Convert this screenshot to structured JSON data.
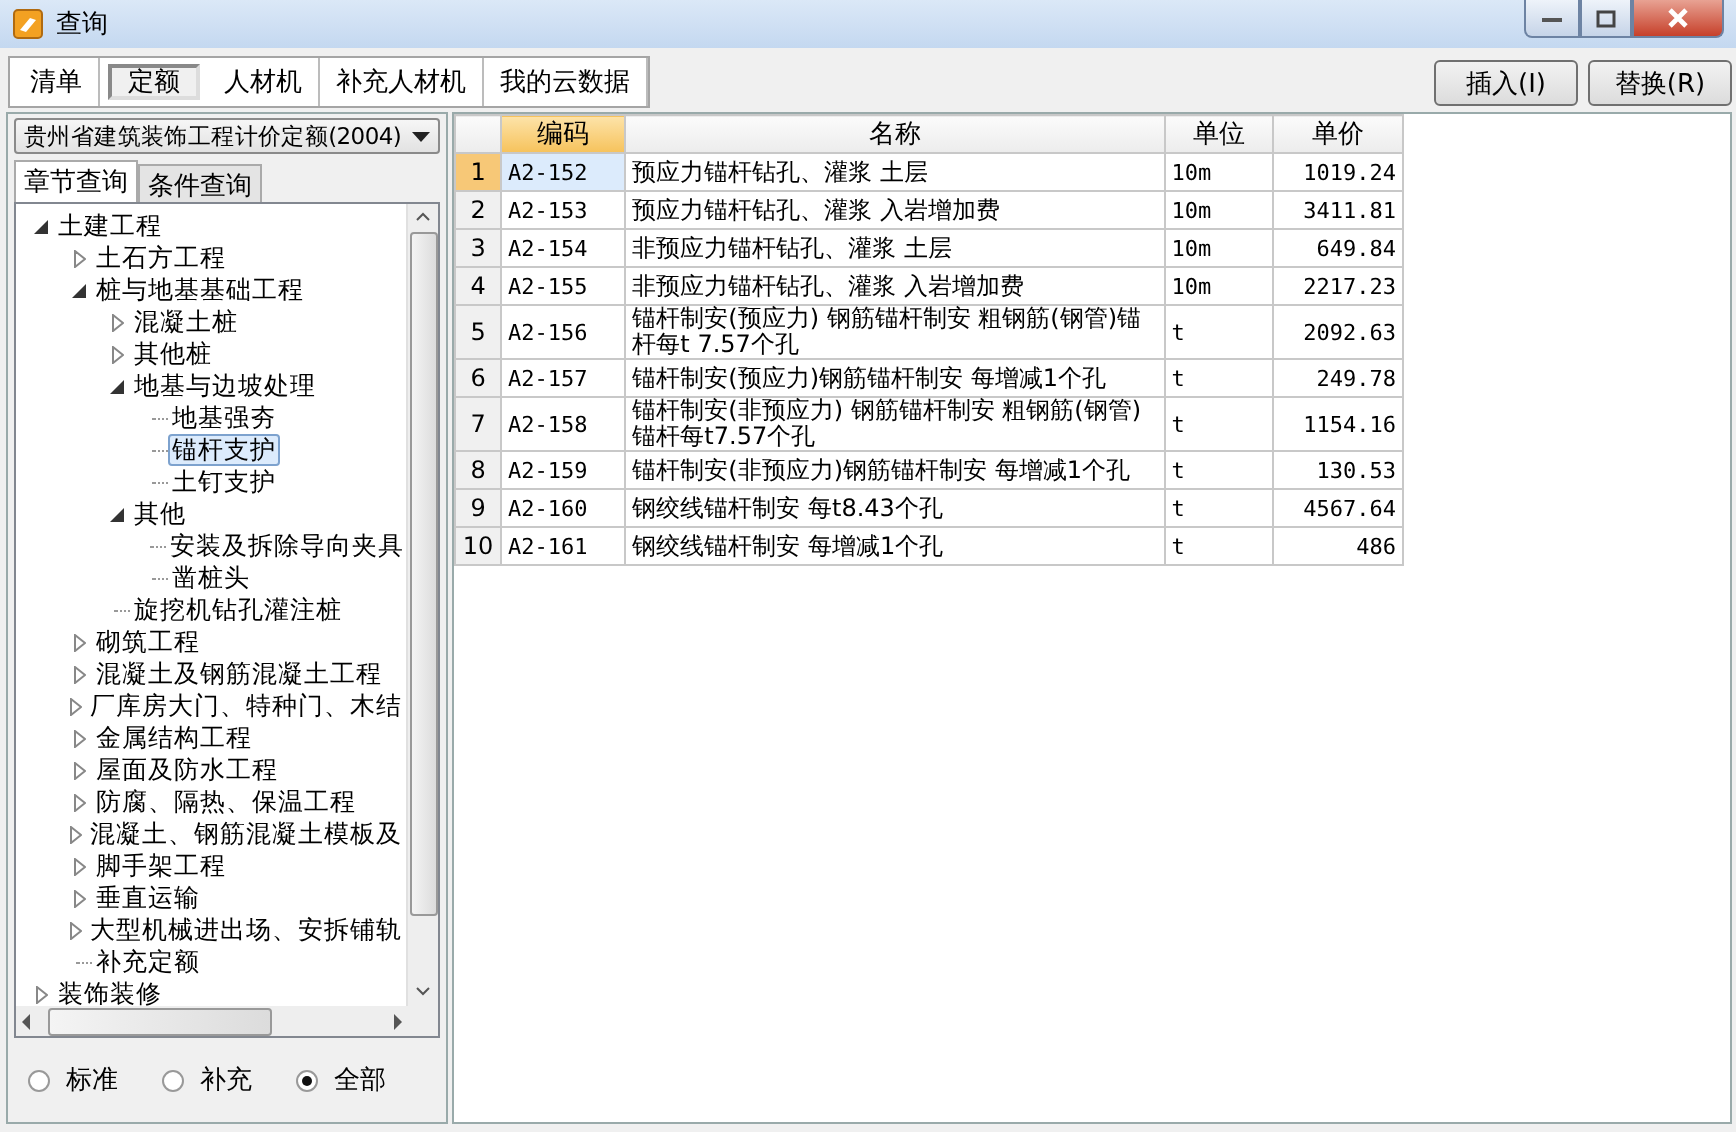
{
  "window": {
    "title": "查询"
  },
  "tabs": [
    {
      "label": "清单",
      "selected": false
    },
    {
      "label": "定额",
      "selected": true
    },
    {
      "label": "人材机",
      "selected": false
    },
    {
      "label": "补充人材机",
      "selected": false
    },
    {
      "label": "我的云数据",
      "selected": false
    }
  ],
  "buttons": [
    "插入(I)",
    "替换(R)"
  ],
  "quota_dropdown": {
    "value": "贵州省建筑装饰工程计价定额(2004)"
  },
  "search_tabs": [
    {
      "label": "章节查询",
      "selected": true
    },
    {
      "label": "条件查询",
      "selected": false
    }
  ],
  "tree": [
    {
      "label": "土建工程",
      "kind": "folder",
      "expanded": true,
      "selected": false,
      "children": [
        {
          "label": "土石方工程",
          "kind": "folder",
          "expanded": false,
          "selected": false
        },
        {
          "label": "桩与地基基础工程",
          "kind": "folder",
          "expanded": true,
          "selected": false,
          "children": [
            {
              "label": "混凝土桩",
              "kind": "folder",
              "expanded": false,
              "selected": false
            },
            {
              "label": "其他桩",
              "kind": "folder",
              "expanded": false,
              "selected": false
            },
            {
              "label": "地基与边坡处理",
              "kind": "folder",
              "expanded": true,
              "selected": false,
              "children": [
                {
                  "label": "地基强夯",
                  "kind": "leaf",
                  "selected": false
                },
                {
                  "label": "锚杆支护",
                  "kind": "leaf",
                  "selected": true
                },
                {
                  "label": "土钉支护",
                  "kind": "leaf",
                  "selected": false
                }
              ]
            },
            {
              "label": "其他",
              "kind": "folder",
              "expanded": true,
              "selected": false,
              "children": [
                {
                  "label": "安装及拆除导向夹具",
                  "kind": "leaf",
                  "selected": false
                },
                {
                  "label": "凿桩头",
                  "kind": "leaf",
                  "selected": false
                }
              ]
            },
            {
              "label": "旋挖机钻孔灌注桩",
              "kind": "leaf",
              "selected": false
            }
          ]
        },
        {
          "label": "砌筑工程",
          "kind": "folder",
          "expanded": false,
          "selected": false
        },
        {
          "label": "混凝土及钢筋混凝土工程",
          "kind": "folder",
          "expanded": false,
          "selected": false
        },
        {
          "label": "厂库房大门、特种门、木结",
          "kind": "folder",
          "expanded": false,
          "selected": false
        },
        {
          "label": "金属结构工程",
          "kind": "folder",
          "expanded": false,
          "selected": false
        },
        {
          "label": "屋面及防水工程",
          "kind": "folder",
          "expanded": false,
          "selected": false
        },
        {
          "label": "防腐、隔热、保温工程",
          "kind": "folder",
          "expanded": false,
          "selected": false
        },
        {
          "label": "混凝土、钢筋混凝土模板及",
          "kind": "folder",
          "expanded": false,
          "selected": false
        },
        {
          "label": "脚手架工程",
          "kind": "folder",
          "expanded": false,
          "selected": false
        },
        {
          "label": "垂直运输",
          "kind": "folder",
          "expanded": false,
          "selected": false
        },
        {
          "label": "大型机械进出场、安拆铺轨",
          "kind": "folder",
          "expanded": false,
          "selected": false
        },
        {
          "label": "补充定额",
          "kind": "leaf",
          "selected": false
        }
      ]
    },
    {
      "label": "装饰装修",
      "kind": "folder",
      "expanded": false,
      "selected": false
    }
  ],
  "filter_options": [
    {
      "label": "标准",
      "selected": false
    },
    {
      "label": "补充",
      "selected": false
    },
    {
      "label": "全部",
      "selected": true
    }
  ],
  "table": {
    "columns": [
      "编码",
      "名称",
      "单位",
      "单价"
    ],
    "rows": [
      {
        "number": "1",
        "code": "A2-152",
        "name": "预应力锚杆钻孔、灌浆 土层",
        "unit": "10m",
        "price": "1019.24",
        "selected": true
      },
      {
        "number": "2",
        "code": "A2-153",
        "name": "预应力锚杆钻孔、灌浆 入岩增加费",
        "unit": "10m",
        "price": "3411.81",
        "selected": false
      },
      {
        "number": "3",
        "code": "A2-154",
        "name": "非预应力锚杆钻孔、灌浆 土层",
        "unit": "10m",
        "price": "649.84",
        "selected": false
      },
      {
        "number": "4",
        "code": "A2-155",
        "name": "非预应力锚杆钻孔、灌浆 入岩增加费",
        "unit": "10m",
        "price": "2217.23",
        "selected": false
      },
      {
        "number": "5",
        "code": "A2-156",
        "name": "锚杆制安(预应力) 钢筋锚杆制安 粗钢筋(钢管)锚杆每t 7.57个孔",
        "unit": "t",
        "price": "2092.63",
        "selected": false
      },
      {
        "number": "6",
        "code": "A2-157",
        "name": "锚杆制安(预应力)钢筋锚杆制安 每增减1个孔",
        "unit": "t",
        "price": "249.78",
        "selected": false
      },
      {
        "number": "7",
        "code": "A2-158",
        "name": "锚杆制安(非预应力) 钢筋锚杆制安 粗钢筋(钢管)锚杆每t7.57个孔",
        "unit": "t",
        "price": "1154.16",
        "selected": false
      },
      {
        "number": "8",
        "code": "A2-159",
        "name": "锚杆制安(非预应力)钢筋锚杆制安 每增减1个孔",
        "unit": "t",
        "price": "130.53",
        "selected": false
      },
      {
        "number": "9",
        "code": "A2-160",
        "name": "钢绞线锚杆制安 每t8.43个孔",
        "unit": "t",
        "price": "4567.64",
        "selected": false
      },
      {
        "number": "10",
        "code": "A2-161",
        "name": "钢绞线锚杆制安 每增减1个孔",
        "unit": "t",
        "price": "486",
        "selected": false
      }
    ]
  }
}
